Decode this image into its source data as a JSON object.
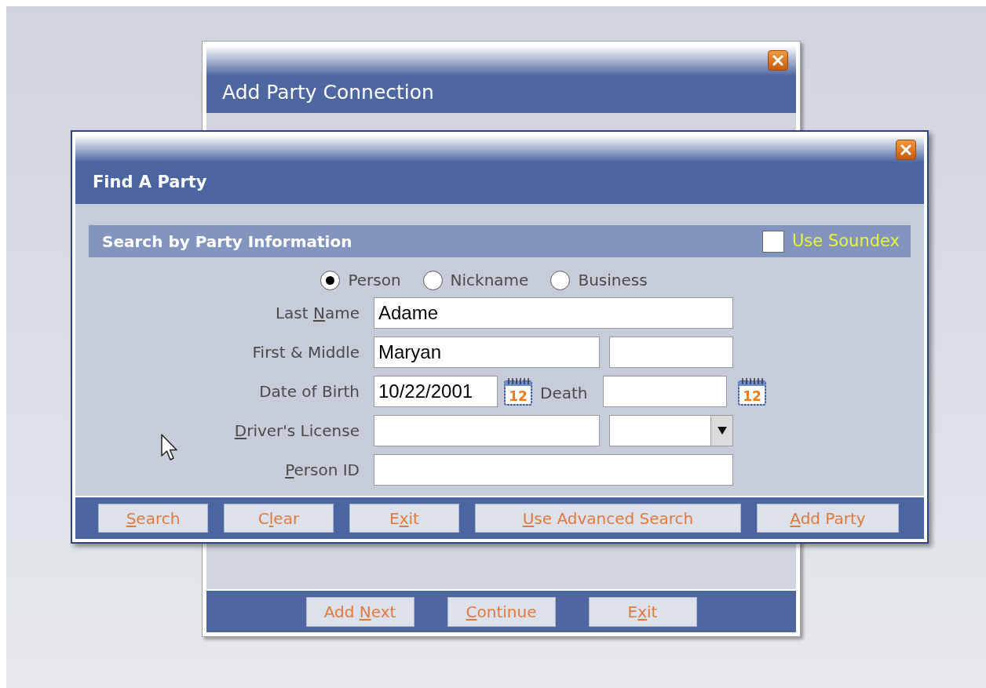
{
  "outer_dialog": {
    "title": "Add Party Connection",
    "buttons": [
      {
        "label_start": "Add ",
        "access_key": "N",
        "label_end": "ext"
      },
      {
        "access_key": "C",
        "label_end": "ontinue"
      },
      {
        "label_start": "E",
        "access_key": "x",
        "label_end": "it"
      }
    ]
  },
  "dialog": {
    "title": "Find A Party",
    "section": {
      "title": "Search by Party Information",
      "soundex": {
        "label": "Use Soundex",
        "checked": false
      }
    },
    "party_types": [
      {
        "label": "Person",
        "selected": true
      },
      {
        "label": "Nickname",
        "selected": false
      },
      {
        "label": "Business",
        "selected": false
      }
    ],
    "fields": [
      {
        "kind": "text",
        "label_start": "Last ",
        "access_key": "N",
        "label_end": "ame",
        "value": "Adame"
      },
      {
        "kind": "pair",
        "label_start": "First & Middle",
        "value": "Maryan"
      },
      {
        "kind": "dates",
        "label_start": "Date of Birth",
        "value": "10/22/2001",
        "calendar_day": "12",
        "death_label": "Death",
        "death_calendar_day": "12"
      },
      {
        "kind": "select",
        "access_key": "D",
        "label_end": "river's License"
      },
      {
        "kind": "text",
        "access_key": "P",
        "label_end": "erson ID"
      }
    ],
    "buttons": [
      {
        "access_key": "S",
        "label_end": "earch"
      },
      {
        "label_start": "C",
        "access_key": "l",
        "label_end": "ear"
      },
      {
        "label_start": "E",
        "access_key": "x",
        "label_end": "it"
      },
      {
        "access_key": "U",
        "label_end": "se Advanced Search"
      },
      {
        "access_key": "A",
        "label_end": "dd Party"
      }
    ]
  }
}
